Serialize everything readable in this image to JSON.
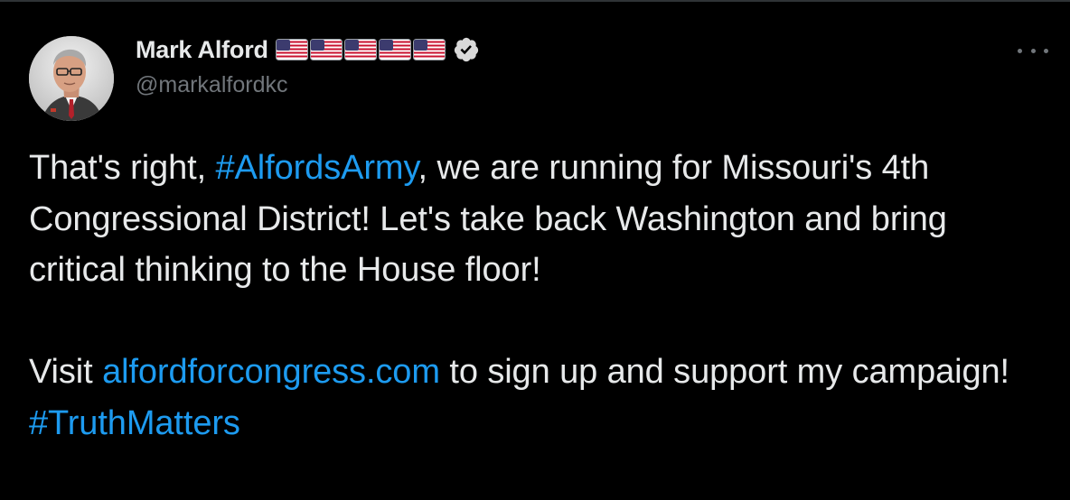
{
  "colors": {
    "background": "#000000",
    "text_primary": "#e7e9ea",
    "text_secondary": "#71767b",
    "link": "#1d9bf0",
    "divider": "#2f3336"
  },
  "author": {
    "display_name": "Mark Alford",
    "handle": "@markalfordkc",
    "name_emoji": [
      "us-flag-icon",
      "us-flag-icon",
      "us-flag-icon",
      "us-flag-icon",
      "us-flag-icon"
    ],
    "badge": "verified-badge-icon",
    "avatar": "avatar"
  },
  "menu": {
    "icon": "more-horizontal-icon"
  },
  "tweet": {
    "p1": {
      "t1": "That's right, ",
      "hashtag1": "#AlfordsArmy",
      "t2": ", we are running for Missouri's 4th Congressional District! Let's take back Washington and bring critical thinking to the House floor!"
    },
    "p2": {
      "t1": "Visit ",
      "url": "alfordforcongress.com",
      "t2": " to sign up and support my campaign! ",
      "hashtag2": "#TruthMatters"
    }
  }
}
